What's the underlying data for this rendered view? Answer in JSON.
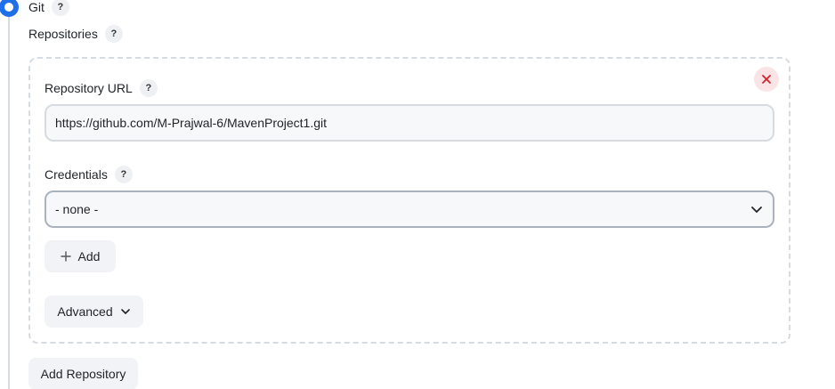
{
  "scm": {
    "option_label": "Git",
    "selected": true,
    "help_label": "?"
  },
  "repositories": {
    "label": "Repositories",
    "help_label": "?"
  },
  "repository": {
    "url_label": "Repository URL",
    "url_help": "?",
    "url_value": "https://github.com/M-Prajwal-6/MavenProject1.git",
    "credentials_label": "Credentials",
    "credentials_help": "?",
    "credentials_selected": "- none -",
    "add_label": "Add",
    "advanced_label": "Advanced",
    "delete_icon": "close-icon"
  },
  "actions": {
    "add_repository_label": "Add Repository"
  },
  "colors": {
    "accent": "#1f6feb",
    "danger": "#d1242f",
    "border": "#d6dbe1"
  }
}
